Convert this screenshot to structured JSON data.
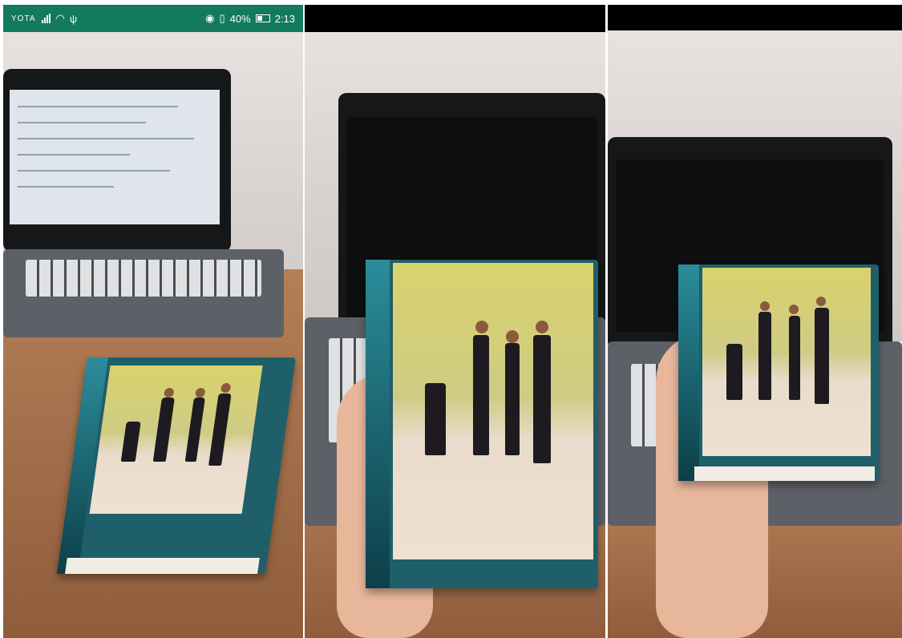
{
  "status_bar": {
    "carrier": "YOTA",
    "battery": "40%",
    "time": "2:13"
  },
  "colors": {
    "status_bar_bg": "#147a5e",
    "black_bar": "#000000"
  },
  "icons": [
    "signal-icon",
    "wifi-icon",
    "usb-icon",
    "eye-icon",
    "vibrate-icon",
    "battery-icon"
  ]
}
